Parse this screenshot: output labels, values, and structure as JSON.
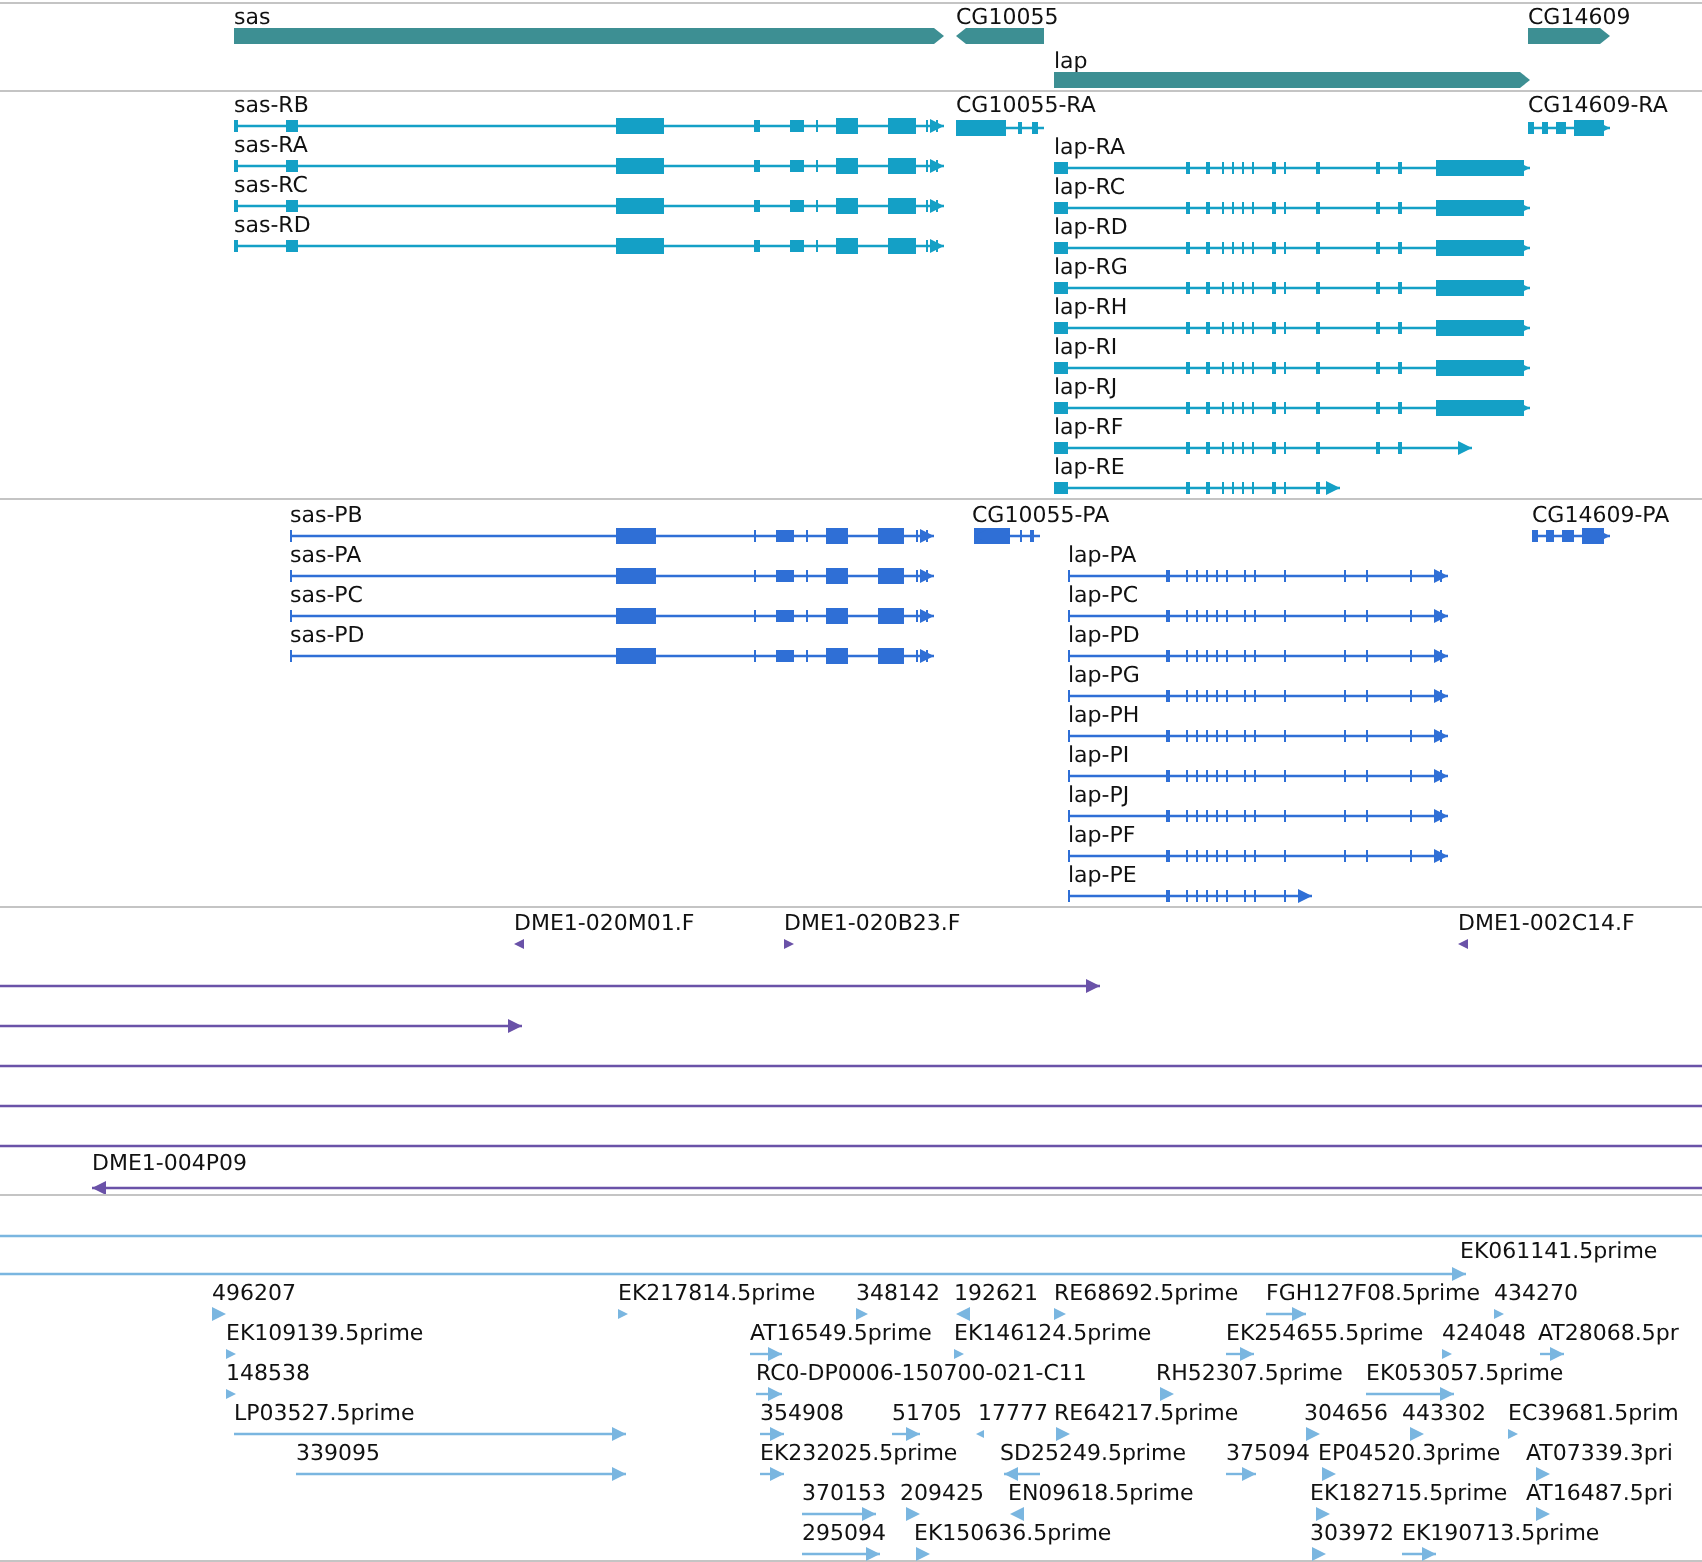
{
  "tracks": [
    {
      "kind": "gene",
      "features": [
        {
          "label": "sas",
          "reverse": false
        },
        {
          "label": "CG10055",
          "reverse": true
        },
        {
          "label": "CG14609",
          "reverse": false
        },
        {
          "label": "lap",
          "reverse": false
        }
      ]
    },
    {
      "kind": "transcript",
      "features": [
        {
          "label": "sas-RB",
          "reverse": false
        },
        {
          "label": "sas-RA",
          "reverse": false
        },
        {
          "label": "sas-RC",
          "reverse": false
        },
        {
          "label": "sas-RD",
          "reverse": false
        },
        {
          "label": "CG10055-RA",
          "reverse": true
        },
        {
          "label": "CG14609-RA",
          "reverse": false
        },
        {
          "label": "lap-RA",
          "reverse": false
        },
        {
          "label": "lap-RC",
          "reverse": false
        },
        {
          "label": "lap-RD",
          "reverse": false
        },
        {
          "label": "lap-RG",
          "reverse": false
        },
        {
          "label": "lap-RH",
          "reverse": false
        },
        {
          "label": "lap-RI",
          "reverse": false
        },
        {
          "label": "lap-RJ",
          "reverse": false
        },
        {
          "label": "lap-RF",
          "reverse": false
        },
        {
          "label": "lap-RE",
          "reverse": false
        }
      ]
    },
    {
      "kind": "protein",
      "features": [
        {
          "label": "sas-PB",
          "reverse": false
        },
        {
          "label": "sas-PA",
          "reverse": false
        },
        {
          "label": "sas-PC",
          "reverse": false
        },
        {
          "label": "sas-PD",
          "reverse": false
        },
        {
          "label": "CG10055-PA",
          "reverse": true
        },
        {
          "label": "CG14609-PA",
          "reverse": false
        },
        {
          "label": "lap-PA",
          "reverse": false
        },
        {
          "label": "lap-PC",
          "reverse": false
        },
        {
          "label": "lap-PD",
          "reverse": false
        },
        {
          "label": "lap-PG",
          "reverse": false
        },
        {
          "label": "lap-PH",
          "reverse": false
        },
        {
          "label": "lap-PI",
          "reverse": false
        },
        {
          "label": "lap-PJ",
          "reverse": false
        },
        {
          "label": "lap-PF",
          "reverse": false
        },
        {
          "label": "lap-PE",
          "reverse": false
        }
      ]
    },
    {
      "kind": "clone",
      "features": [
        {
          "kind": "labeled",
          "label": "DME1-020M01.F",
          "reverse": true
        },
        {
          "kind": "labeled",
          "label": "DME1-020B23.F",
          "reverse": false
        },
        {
          "kind": "labeled",
          "label": "DME1-002C14.F",
          "reverse": true
        },
        {
          "kind": "arrow",
          "reverse": false
        },
        {
          "kind": "arrow",
          "reverse": false
        },
        {
          "kind": "span"
        },
        {
          "kind": "span"
        },
        {
          "kind": "span"
        },
        {
          "kind": "labeled",
          "label": "DME1-004P09",
          "reverse": true
        }
      ]
    },
    {
      "kind": "est",
      "features": [
        {
          "kind": "span"
        },
        {
          "kind": "labeled",
          "label": "EK061141.5prime",
          "reverse": false
        },
        {
          "kind": "labeled",
          "label": "496207",
          "reverse": false
        },
        {
          "kind": "labeled",
          "label": "EK217814.5prime",
          "reverse": false
        },
        {
          "kind": "labeled",
          "label": "348142",
          "reverse": false
        },
        {
          "kind": "labeled",
          "label": "192621",
          "reverse": true
        },
        {
          "kind": "labeled",
          "label": "RE68692.5prime",
          "reverse": false
        },
        {
          "kind": "labeled",
          "label": "FGH127F08.5prime",
          "reverse": false
        },
        {
          "kind": "labeled",
          "label": "434270",
          "reverse": false
        },
        {
          "kind": "labeled",
          "label": "EK109139.5prime",
          "reverse": false
        },
        {
          "kind": "labeled",
          "label": "AT16549.5prime",
          "reverse": false
        },
        {
          "kind": "labeled",
          "label": "EK146124.5prime",
          "reverse": false
        },
        {
          "kind": "labeled",
          "label": "EK254655.5prime",
          "reverse": false
        },
        {
          "kind": "labeled",
          "label": "424048",
          "reverse": false
        },
        {
          "kind": "labeled",
          "label": "AT28068.5pr",
          "reverse": false
        },
        {
          "kind": "labeled",
          "label": "148538",
          "reverse": false
        },
        {
          "kind": "labeled",
          "label": "RC0-DP0006-150700-021-C11",
          "reverse": false
        },
        {
          "kind": "labeled",
          "label": "RH52307.5prime",
          "reverse": false
        },
        {
          "kind": "labeled",
          "label": "EK053057.5prime",
          "reverse": false
        },
        {
          "kind": "labeled",
          "label": "LP03527.5prime",
          "reverse": false
        },
        {
          "kind": "labeled",
          "label": "354908",
          "reverse": false
        },
        {
          "kind": "labeled",
          "label": "51705",
          "reverse": false
        },
        {
          "kind": "labeled",
          "label": "17777",
          "reverse": true
        },
        {
          "kind": "labeled",
          "label": "RE64217.5prime",
          "reverse": false
        },
        {
          "kind": "labeled",
          "label": "304656",
          "reverse": false
        },
        {
          "kind": "labeled",
          "label": "443302",
          "reverse": false
        },
        {
          "kind": "labeled",
          "label": "EC39681.5prim",
          "reverse": false
        },
        {
          "kind": "labeled",
          "label": "339095",
          "reverse": false
        },
        {
          "kind": "labeled",
          "label": "EK232025.5prime",
          "reverse": false
        },
        {
          "kind": "labeled",
          "label": "SD25249.5prime",
          "reverse": true
        },
        {
          "kind": "labeled",
          "label": "375094",
          "reverse": false
        },
        {
          "kind": "labeled",
          "label": "EP04520.3prime",
          "reverse": false
        },
        {
          "kind": "labeled",
          "label": "AT07339.3pri",
          "reverse": false
        },
        {
          "kind": "labeled",
          "label": "370153",
          "reverse": false
        },
        {
          "kind": "labeled",
          "label": "209425",
          "reverse": false
        },
        {
          "kind": "labeled",
          "label": "EN09618.5prime",
          "reverse": true
        },
        {
          "kind": "labeled",
          "label": "EK182715.5prime",
          "reverse": false
        },
        {
          "kind": "labeled",
          "label": "AT16487.5pri",
          "reverse": false
        },
        {
          "kind": "labeled",
          "label": "295094",
          "reverse": false
        },
        {
          "kind": "labeled",
          "label": "EK150636.5prime",
          "reverse": false
        },
        {
          "kind": "labeled",
          "label": "303972",
          "reverse": false
        },
        {
          "kind": "labeled",
          "label": "EK190713.5prime",
          "reverse": false
        }
      ]
    }
  ]
}
